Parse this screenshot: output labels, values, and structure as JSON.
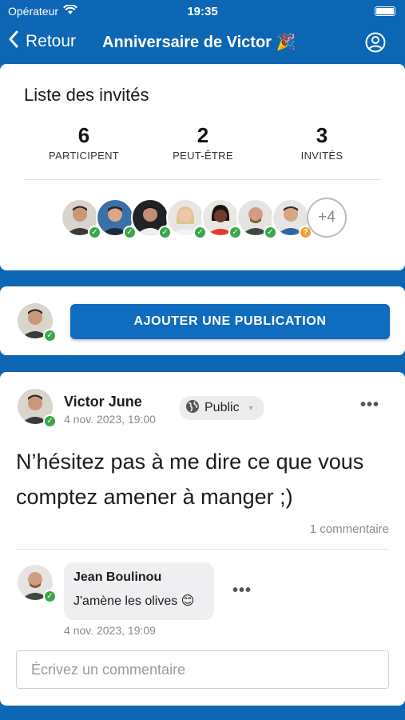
{
  "status_bar": {
    "carrier": "Opérateur",
    "time": "19:35"
  },
  "nav": {
    "back_label": "Retour",
    "title": "Anniversaire de Victor 🎉"
  },
  "guests": {
    "heading": "Liste des invités",
    "stats": [
      {
        "value": "6",
        "label": "PARTICIPENT"
      },
      {
        "value": "2",
        "label": "PEUT-ÊTRE"
      },
      {
        "value": "3",
        "label": "INVITÉS"
      }
    ],
    "more_count": "+4"
  },
  "publish": {
    "button_label": "AJOUTER UNE PUBLICATION"
  },
  "post": {
    "author": "Victor June",
    "date": "4 nov. 2023, 19:00",
    "privacy": "Public",
    "text": "N’hésitez pas à me dire ce que vous comptez amener à manger ;)",
    "comment_count": "1 commentaire",
    "comment": {
      "author": "Jean Boulinou",
      "text": "J'amène les olives 😊",
      "date": "4 nov. 2023, 19:09"
    },
    "comment_placeholder": "Écrivez un commentaire"
  },
  "colors": {
    "brand_blue": "#0c66b3",
    "going_green": "#3aa64d",
    "maybe_orange": "#f0a229"
  }
}
